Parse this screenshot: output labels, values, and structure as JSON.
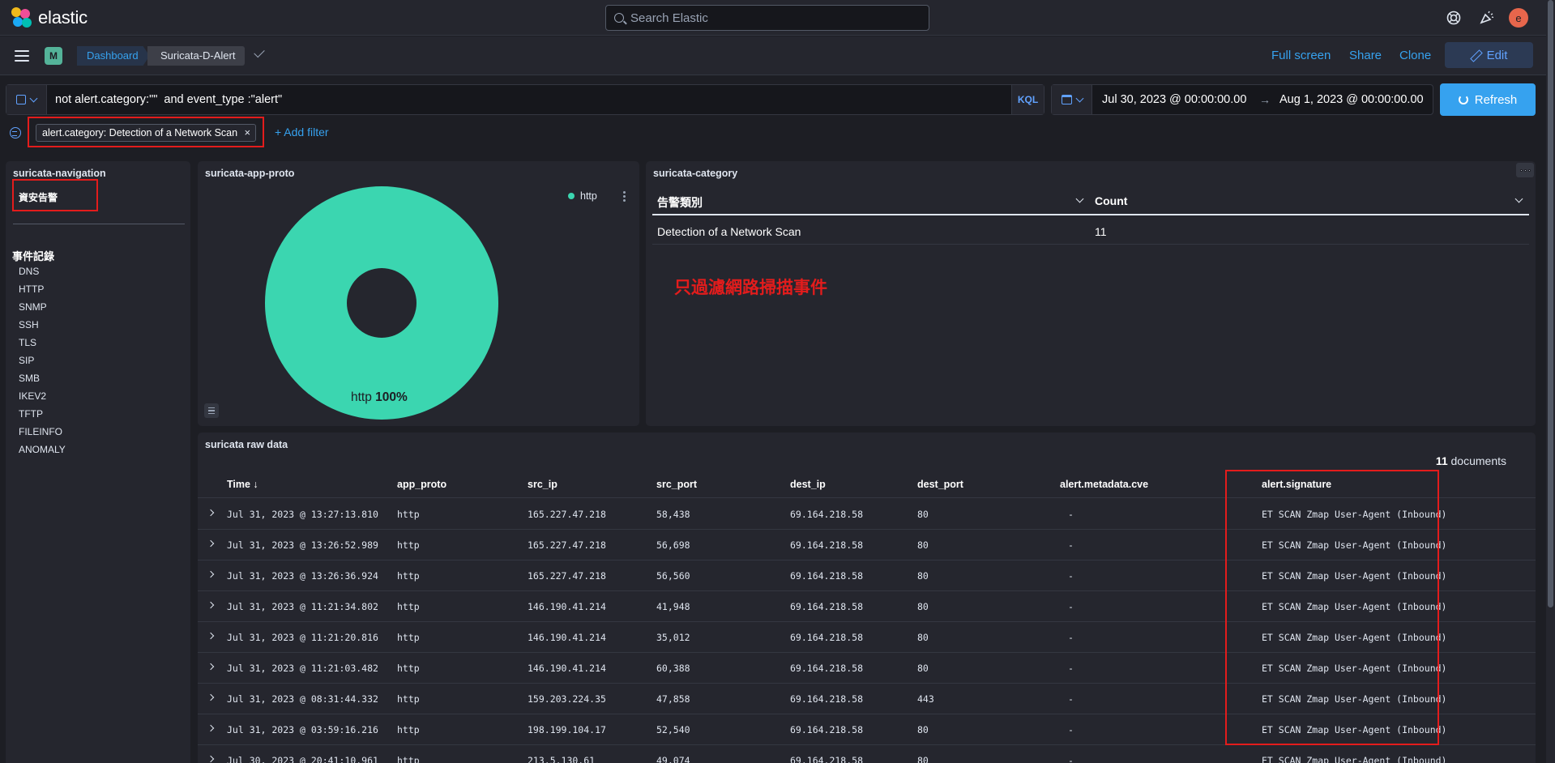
{
  "header": {
    "logo_text": "elastic",
    "search_placeholder": "Search Elastic",
    "avatar_letter": "e"
  },
  "subbar": {
    "space_letter": "M",
    "breadcrumbs": [
      "Dashboard",
      "Suricata-D-Alert"
    ],
    "full_screen": "Full screen",
    "share": "Share",
    "clone": "Clone",
    "edit": "Edit"
  },
  "query": {
    "text": "not alert.category:\"\"  and event_type :\"alert\"",
    "language": "KQL",
    "date_start": "Jul 30, 2023 @ 00:00:00.00",
    "date_arrow": "→",
    "date_end": "Aug 1, 2023 @ 00:00:00.00",
    "refresh": "Refresh"
  },
  "filters": {
    "pill": "alert.category: Detection of a Network Scan",
    "pill_remove": "×",
    "add": "+ Add filter"
  },
  "navigation": {
    "title": "suricata-navigation",
    "alert_link": "資安告警",
    "events_heading": "事件記錄",
    "items": [
      "DNS",
      "HTTP",
      "SNMP",
      "SSH",
      "TLS",
      "SIP",
      "SMB",
      "IKEV2",
      "TFTP",
      "FILEINFO",
      "ANOMALY"
    ]
  },
  "app_proto": {
    "title": "suricata-app-proto",
    "legend": "http",
    "slice_label": "http",
    "slice_percent": "100%"
  },
  "category": {
    "title": "suricata-category",
    "col_category": "告警類別",
    "col_count": "Count",
    "row_category": "Detection of a Network Scan",
    "row_count": "11",
    "annotation": "只過濾網路掃描事件"
  },
  "raw": {
    "title": "suricata raw data",
    "count": "11",
    "count_suffix": " documents",
    "columns": [
      "Time ↓",
      "app_proto",
      "src_ip",
      "src_port",
      "dest_ip",
      "dest_port",
      "alert.metadata.cve",
      "alert.signature"
    ],
    "rows": [
      [
        "Jul 31, 2023 @ 13:27:13.810",
        "http",
        "165.227.47.218",
        "58,438",
        "69.164.218.58",
        "80",
        "-",
        "ET SCAN Zmap User-Agent (Inbound)"
      ],
      [
        "Jul 31, 2023 @ 13:26:52.989",
        "http",
        "165.227.47.218",
        "56,698",
        "69.164.218.58",
        "80",
        "-",
        "ET SCAN Zmap User-Agent (Inbound)"
      ],
      [
        "Jul 31, 2023 @ 13:26:36.924",
        "http",
        "165.227.47.218",
        "56,560",
        "69.164.218.58",
        "80",
        "-",
        "ET SCAN Zmap User-Agent (Inbound)"
      ],
      [
        "Jul 31, 2023 @ 11:21:34.802",
        "http",
        "146.190.41.214",
        "41,948",
        "69.164.218.58",
        "80",
        "-",
        "ET SCAN Zmap User-Agent (Inbound)"
      ],
      [
        "Jul 31, 2023 @ 11:21:20.816",
        "http",
        "146.190.41.214",
        "35,012",
        "69.164.218.58",
        "80",
        "-",
        "ET SCAN Zmap User-Agent (Inbound)"
      ],
      [
        "Jul 31, 2023 @ 11:21:03.482",
        "http",
        "146.190.41.214",
        "60,388",
        "69.164.218.58",
        "80",
        "-",
        "ET SCAN Zmap User-Agent (Inbound)"
      ],
      [
        "Jul 31, 2023 @ 08:31:44.332",
        "http",
        "159.203.224.35",
        "47,858",
        "69.164.218.58",
        "443",
        "-",
        "ET SCAN Zmap User-Agent (Inbound)"
      ],
      [
        "Jul 31, 2023 @ 03:59:16.216",
        "http",
        "198.199.104.17",
        "52,540",
        "69.164.218.58",
        "80",
        "-",
        "ET SCAN Zmap User-Agent (Inbound)"
      ],
      [
        "Jul 30, 2023 @ 20:41:10.961",
        "http",
        "213.5.130.61",
        "49,074",
        "69.164.218.58",
        "80",
        "-",
        "ET SCAN Zmap User-Agent (Inbound)"
      ]
    ]
  },
  "colors": {
    "accent": "#36a2ef",
    "pie": "#3bd6b0",
    "highlight": "#e31c1c",
    "background": "#1d1e24",
    "panel": "#25262e"
  },
  "icons": [
    "elastic-logo-icon",
    "search-icon",
    "help-icon",
    "newsfeed-icon",
    "menu-icon",
    "check-icon",
    "pencil-icon",
    "saved-query-icon",
    "calendar-icon",
    "refresh-icon",
    "filter-icon",
    "kebab-icon",
    "expand-icon",
    "sort-down-icon"
  ]
}
